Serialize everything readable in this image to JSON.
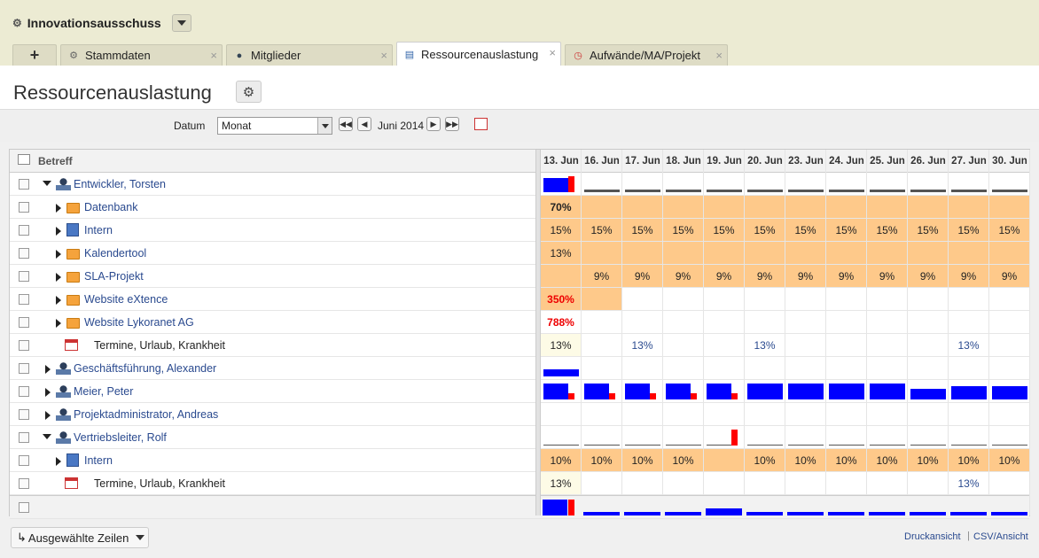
{
  "app": {
    "title": "Innovationsausschuss"
  },
  "tabs": [
    {
      "label": "Stammdaten"
    },
    {
      "label": "Mitglieder"
    },
    {
      "label": "Ressourcenauslastung"
    },
    {
      "label": "Aufwände/MA/Projekt"
    }
  ],
  "page": {
    "title": "Ressourcenauslastung"
  },
  "toolbar": {
    "datum_label": "Datum",
    "period_value": "Monat",
    "month_label": "Juni 2014"
  },
  "grid": {
    "col_header": "Betreff",
    "days": [
      "13. Jun",
      "16. Jun",
      "17. Jun",
      "18. Jun",
      "19. Jun",
      "20. Jun",
      "23. Jun",
      "24. Jun",
      "25. Jun",
      "26. Jun",
      "27. Jun",
      "30. Jun"
    ],
    "rows": [
      {
        "label": "Entwickler, Torsten",
        "type": "person",
        "level": 0,
        "state": "expanded"
      },
      {
        "label": "Datenbank",
        "type": "folder",
        "level": 1,
        "state": "collapsed",
        "cells": [
          "70%",
          "",
          "",
          "",
          "",
          "",
          "",
          "",
          "",
          "",
          "",
          ""
        ],
        "orange": "all",
        "first_style": "bold"
      },
      {
        "label": "Intern",
        "type": "building",
        "level": 1,
        "state": "collapsed",
        "cells": [
          "15%",
          "15%",
          "15%",
          "15%",
          "15%",
          "15%",
          "15%",
          "15%",
          "15%",
          "15%",
          "15%",
          "15%"
        ],
        "orange": "all"
      },
      {
        "label": "Kalendertool",
        "type": "folder",
        "level": 1,
        "state": "collapsed",
        "cells": [
          "13%",
          "",
          "",
          "",
          "",
          "",
          "",
          "",
          "",
          "",
          "",
          ""
        ],
        "orange": "all"
      },
      {
        "label": "SLA-Projekt",
        "type": "folder",
        "level": 1,
        "state": "collapsed",
        "cells": [
          "",
          "9%",
          "9%",
          "9%",
          "9%",
          "9%",
          "9%",
          "9%",
          "9%",
          "9%",
          "9%",
          "9%"
        ],
        "orange": "all"
      },
      {
        "label": "Website eXtence",
        "type": "folder",
        "level": 1,
        "state": "collapsed",
        "cells": [
          "350%",
          "",
          "",
          "",
          "",
          "",
          "",
          "",
          "",
          "",
          "",
          ""
        ],
        "orange": "first2",
        "first_style": "red"
      },
      {
        "label": "Website Lykoranet AG",
        "type": "folder",
        "level": 1,
        "state": "collapsed",
        "cells": [
          "788%",
          "",
          "",
          "",
          "",
          "",
          "",
          "",
          "",
          "",
          "",
          ""
        ],
        "first_style": "red"
      },
      {
        "label": "Termine, Urlaub, Krankheit",
        "type": "calendar",
        "level": 1,
        "state": "none",
        "cells": [
          "13%",
          "",
          "13%",
          "",
          "",
          "13%",
          "",
          "",
          "",
          "",
          "13%",
          ""
        ],
        "first_style": "light"
      },
      {
        "label": "Geschäftsführung, Alexander",
        "type": "person",
        "level": 0,
        "state": "collapsed"
      },
      {
        "label": "Meier, Peter",
        "type": "person",
        "level": 0,
        "state": "collapsed"
      },
      {
        "label": "Projektadministrator, Andreas",
        "type": "person",
        "level": 0,
        "state": "collapsed"
      },
      {
        "label": "Vertriebsleiter, Rolf",
        "type": "person",
        "level": 0,
        "state": "expanded"
      },
      {
        "label": "Intern",
        "type": "building",
        "level": 1,
        "state": "collapsed",
        "cells": [
          "10%",
          "10%",
          "10%",
          "10%",
          "",
          "10%",
          "10%",
          "10%",
          "10%",
          "10%",
          "10%",
          "10%"
        ],
        "orange": "all"
      },
      {
        "label": "Termine, Urlaub, Krankheit",
        "type": "calendar",
        "level": 1,
        "state": "none",
        "cells": [
          "13%",
          "",
          "",
          "",
          "",
          "",
          "",
          "",
          "",
          "",
          "13%",
          ""
        ],
        "first_style": "light"
      }
    ]
  },
  "footer": {
    "selected_rows_label": "Ausgewählte Zeilen",
    "print_link": "Druckansicht",
    "csv_link": "CSV/Ansicht",
    "separator": "|"
  }
}
